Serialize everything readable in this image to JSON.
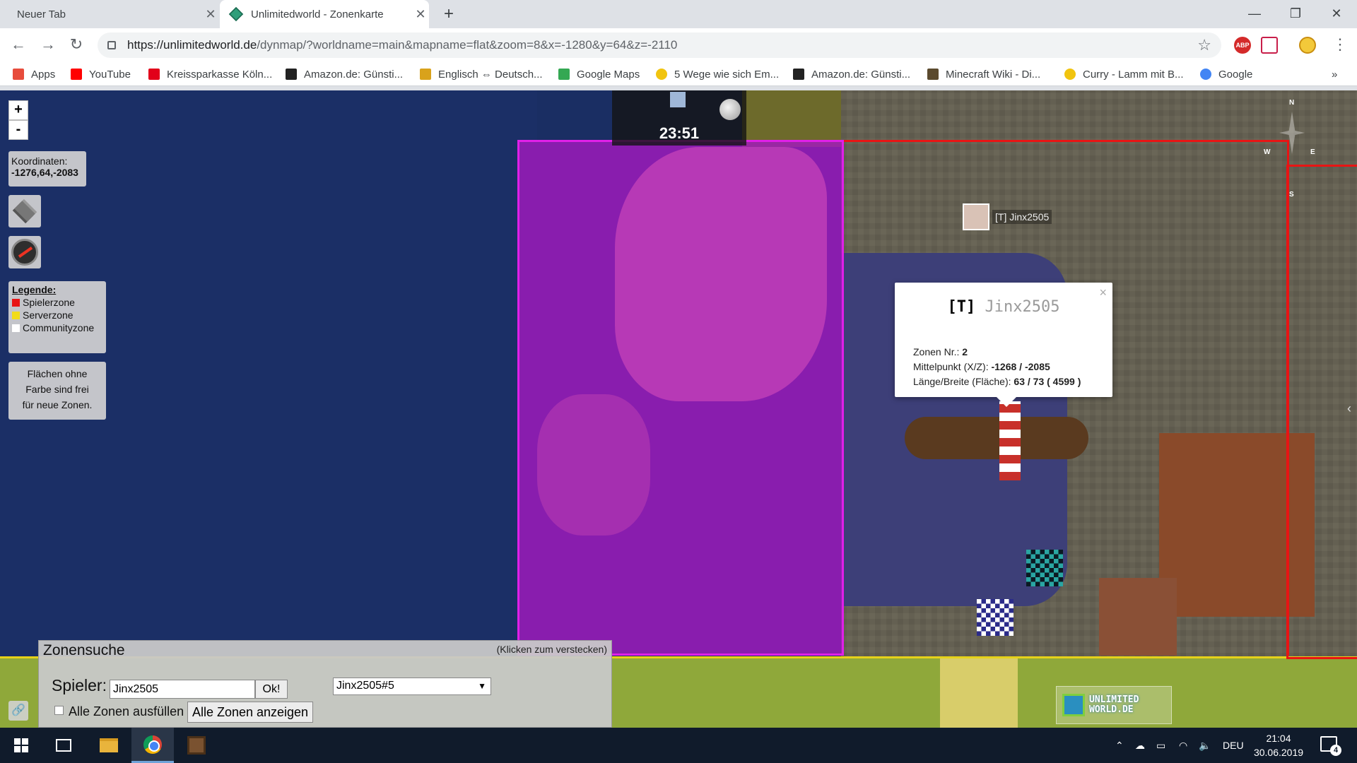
{
  "tabs": [
    {
      "title": "Neuer Tab"
    },
    {
      "title": "Unlimitedworld - Zonenkarte"
    }
  ],
  "address": {
    "host": "https://unlimitedworld.de",
    "path": "/dynmap/?worldname=main&mapname=flat&zoom=8&x=-1280&y=64&z=-2110"
  },
  "extensions": {
    "abp": "ABP"
  },
  "bookmarks": [
    {
      "label": "Apps",
      "icon": "apps-grid-icon",
      "color": "#e74c3c"
    },
    {
      "label": "YouTube",
      "icon": "youtube-icon",
      "color": "#ff0000"
    },
    {
      "label": "Kreissparkasse Köln...",
      "icon": "sparkasse-icon",
      "color": "#e2001a"
    },
    {
      "label": "Amazon.de: Günsti...",
      "icon": "amazon-icon",
      "color": "#222222"
    },
    {
      "label": "Englisch ⇔ Deutsch...",
      "icon": "dictionary-icon",
      "color": "#d9a21b"
    },
    {
      "label": "Google Maps",
      "icon": "google-maps-icon",
      "color": "#34a853"
    },
    {
      "label": "5 Wege wie sich Em...",
      "icon": "emoji-icon",
      "color": "#f1c40f"
    },
    {
      "label": "Amazon.de: Günsti...",
      "icon": "amazon-icon",
      "color": "#222222"
    },
    {
      "label": "Minecraft Wiki - Di...",
      "icon": "minecraft-icon",
      "color": "#5b4a2e"
    },
    {
      "label": "Curry - Lamm mit B...",
      "icon": "radiation-icon",
      "color": "#f1c40f"
    },
    {
      "label": "Google",
      "icon": "google-icon",
      "color": "#4285f4"
    }
  ],
  "map": {
    "zoom_in": "+",
    "zoom_out": "-",
    "clock_time": "23:51",
    "coords_label": "Koordinaten:",
    "coords_value": "-1276,64,-2083",
    "legend": {
      "title": "Legende:",
      "items": [
        {
          "label": "Spielerzone",
          "color": "#e81414"
        },
        {
          "label": "Serverzone",
          "color": "#f2dc1a"
        },
        {
          "label": "Communityzone",
          "color": "#ffffff"
        }
      ]
    },
    "hint": [
      "Flächen ohne",
      "Farbe sind frei",
      "für neue Zonen."
    ],
    "compass": {
      "n": "N",
      "e": "E",
      "s": "S",
      "w": "W"
    },
    "player_name": "[T] Jinx2505"
  },
  "popup": {
    "tag": "[T]",
    "name": "Jinx2505",
    "close": "×",
    "zone_label": "Zonen Nr.:",
    "zone_value": "2",
    "center_label": "Mittelpunkt (X/Z):",
    "center_value": "-1268 / -2085",
    "size_label": "Länge/Breite (Fläche):",
    "size_value": "63 / 73 ( 4599 )"
  },
  "zonesearch": {
    "title": "Zonensuche",
    "hide_hint": "(Klicken zum verstecken)",
    "player_label": "Spieler:",
    "player_value": "Jinx2505",
    "ok": "Ok!",
    "select_value": "Jinx2505#5",
    "fill_all": "Alle Zonen ausfüllen",
    "show_all": "Alle Zonen anzeigen"
  },
  "logo": {
    "line1": "UNLIMITED",
    "line2": "WORLD.DE"
  },
  "taskbar": {
    "lang": "DEU",
    "time": "21:04",
    "date": "30.06.2019",
    "notifications": "4"
  }
}
